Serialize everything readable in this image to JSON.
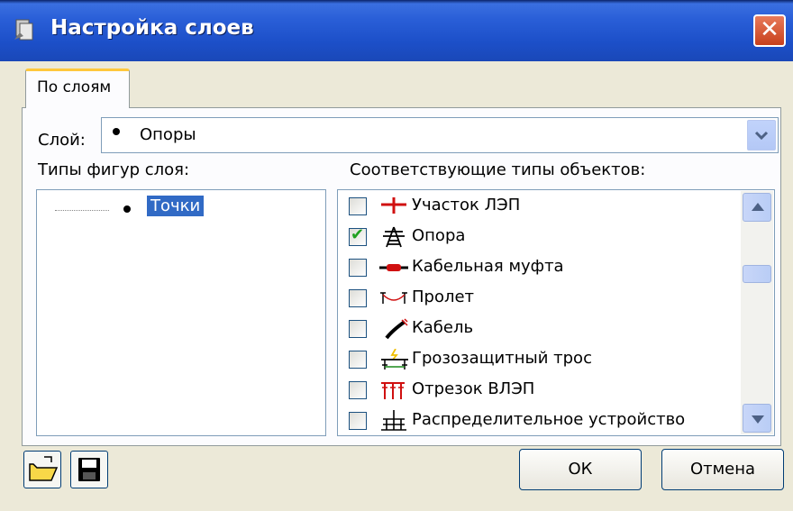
{
  "window": {
    "title": "Настройка слоев",
    "close_symbol": "✕"
  },
  "tabs": [
    {
      "label": "По слоям",
      "active": true
    }
  ],
  "layer": {
    "label": "Слой:",
    "value": "Опоры"
  },
  "shape_types": {
    "heading": "Типы фигур слоя:",
    "items": [
      {
        "label": "Точки",
        "selected": true
      }
    ]
  },
  "object_types": {
    "heading": "Соответствующие типы объектов:",
    "items": [
      {
        "label": "Участок ЛЭП",
        "checked": false,
        "icon": "power-line-section-icon"
      },
      {
        "label": "Опора",
        "checked": true,
        "icon": "pylon-icon"
      },
      {
        "label": "Кабельная муфта",
        "checked": false,
        "icon": "cable-joint-icon"
      },
      {
        "label": "Пролет",
        "checked": false,
        "icon": "span-icon"
      },
      {
        "label": "Кабель",
        "checked": false,
        "icon": "cable-icon"
      },
      {
        "label": "Грозозащитный трос",
        "checked": false,
        "icon": "lightning-wire-icon"
      },
      {
        "label": "Отрезок ВЛЭП",
        "checked": false,
        "icon": "overhead-line-segment-icon"
      },
      {
        "label": "Распределительное устройство",
        "checked": false,
        "icon": "switchgear-icon"
      }
    ]
  },
  "buttons": {
    "ok": "ОК",
    "cancel": "Отмена"
  },
  "colors": {
    "titlebar": "#2a5fd8",
    "selection": "#316ac5",
    "checkmark": "#21a121",
    "tab_highlight": "#ffc83c"
  }
}
